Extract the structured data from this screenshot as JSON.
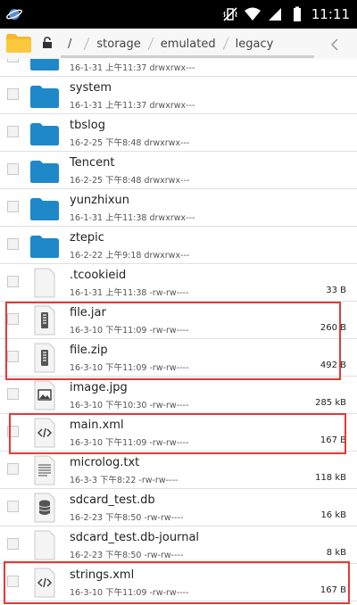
{
  "status_bar": {
    "time": "11:11",
    "icons": [
      "globe-logo-icon",
      "vibrate-icon",
      "wifi-icon",
      "signal-icon",
      "battery-icon"
    ]
  },
  "toolbar": {
    "breadcrumbs": [
      "/",
      "storage",
      "emulated",
      "legacy"
    ],
    "icons": [
      "folder-icon",
      "lock-icon",
      "chevron-left-icon"
    ]
  },
  "files": [
    {
      "name": "",
      "meta": "16-1-31 上午11:37  drwxrwx---",
      "size": "",
      "type": "folder"
    },
    {
      "name": "system",
      "meta": "16-1-31 上午11:37  drwxrwx---",
      "size": "",
      "type": "folder"
    },
    {
      "name": "tbslog",
      "meta": "16-2-25 下午8:48  drwxrwx---",
      "size": "",
      "type": "folder"
    },
    {
      "name": "Tencent",
      "meta": "16-2-25 下午8:48  drwxrwx---",
      "size": "",
      "type": "folder"
    },
    {
      "name": "yunzhixun",
      "meta": "16-1-31 上午11:38  drwxrwx---",
      "size": "",
      "type": "folder"
    },
    {
      "name": "ztepic",
      "meta": "16-2-22 上午9:18  drwxrwx---",
      "size": "",
      "type": "folder"
    },
    {
      "name": ".tcookieid",
      "meta": "16-1-31 上午11:38  -rw-rw----",
      "size": "33 B",
      "type": "file"
    },
    {
      "name": "file.jar",
      "meta": "16-3-10 下午11:09  -rw-rw----",
      "size": "260 B",
      "type": "archive"
    },
    {
      "name": "file.zip",
      "meta": "16-3-10 下午11:09  -rw-rw----",
      "size": "492 B",
      "type": "archive"
    },
    {
      "name": "image.jpg",
      "meta": "16-3-10 下午10:30  -rw-rw----",
      "size": "285 kB",
      "type": "image"
    },
    {
      "name": "main.xml",
      "meta": "16-3-10 下午11:09  -rw-rw----",
      "size": "167 B",
      "type": "code"
    },
    {
      "name": "microlog.txt",
      "meta": "16-3-3 下午8:22  -rw-rw----",
      "size": "118 kB",
      "type": "text"
    },
    {
      "name": "sdcard_test.db",
      "meta": "16-2-23 下午8:50  -rw-rw----",
      "size": "16 kB",
      "type": "database"
    },
    {
      "name": "sdcard_test.db-journal",
      "meta": "16-2-23 下午8:50  -rw-rw----",
      "size": "8 kB",
      "type": "file"
    },
    {
      "name": "strings.xml",
      "meta": "16-3-10 下午11:09  -rw-rw----",
      "size": "167 B",
      "type": "code"
    }
  ],
  "highlight_color": "#e53935",
  "folder_color": "#1e88c8"
}
